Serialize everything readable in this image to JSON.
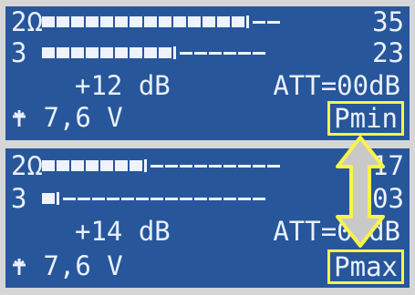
{
  "panel_top": {
    "row1": {
      "channel": "2Ω",
      "bars_filled": 14,
      "bars_empty": 2,
      "value": "35"
    },
    "row2": {
      "channel": "3",
      "bars_filled": 9,
      "bars_empty": 6,
      "value": "23"
    },
    "level": "+12 dB",
    "att": "ATT=00dB",
    "voltage": "7,6 V",
    "mode": "Pmin"
  },
  "panel_bottom": {
    "row1": {
      "channel": "2Ω",
      "bars_filled": 7,
      "bars_empty": 9,
      "value": "17"
    },
    "row2": {
      "channel": "3",
      "bars_filled": 1,
      "bars_empty": 14,
      "value": "03"
    },
    "level": "+14 dB",
    "att": "ATT=00dB",
    "voltage": "7,6 V",
    "mode": "Pmax"
  },
  "icons": {
    "antenna": "antenna-icon",
    "double_arrow": "up-down-arrow-icon"
  },
  "colors": {
    "lcd_bg": "#27569a",
    "lcd_fg": "#eaf0ff",
    "highlight": "#f7f44a",
    "bezel": "#d6d6d6"
  }
}
